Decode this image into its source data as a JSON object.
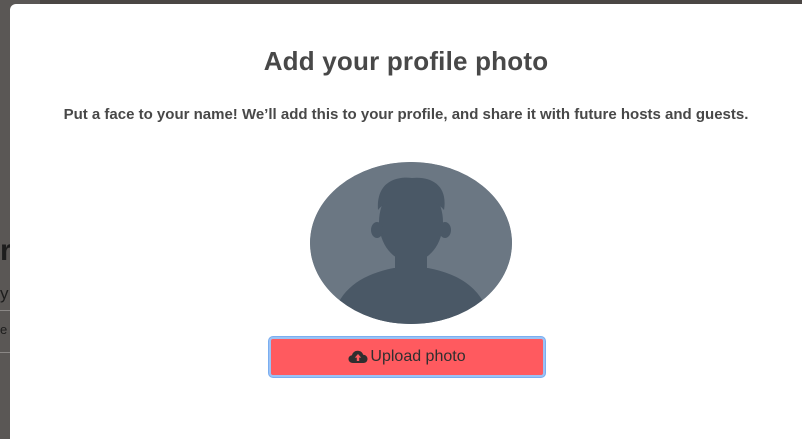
{
  "modal": {
    "title": "Add your profile photo",
    "subtitle": "Put a face to your name! We’ll add this to your profile, and share it with future hosts and guests.",
    "upload_button_label": "Upload photo",
    "upload_icon": "cloud-upload-icon",
    "avatar_icon": "default-avatar-silhouette"
  },
  "background": {
    "fragment_large": "r",
    "fragment_medium": "y",
    "fragment_small": "e"
  },
  "colors": {
    "button_bg": "#ff5a5f",
    "button_focus_border": "#9bc2f5",
    "avatar_bg": "#6b7783",
    "avatar_silhouette": "#4a5866",
    "text": "#484848"
  }
}
